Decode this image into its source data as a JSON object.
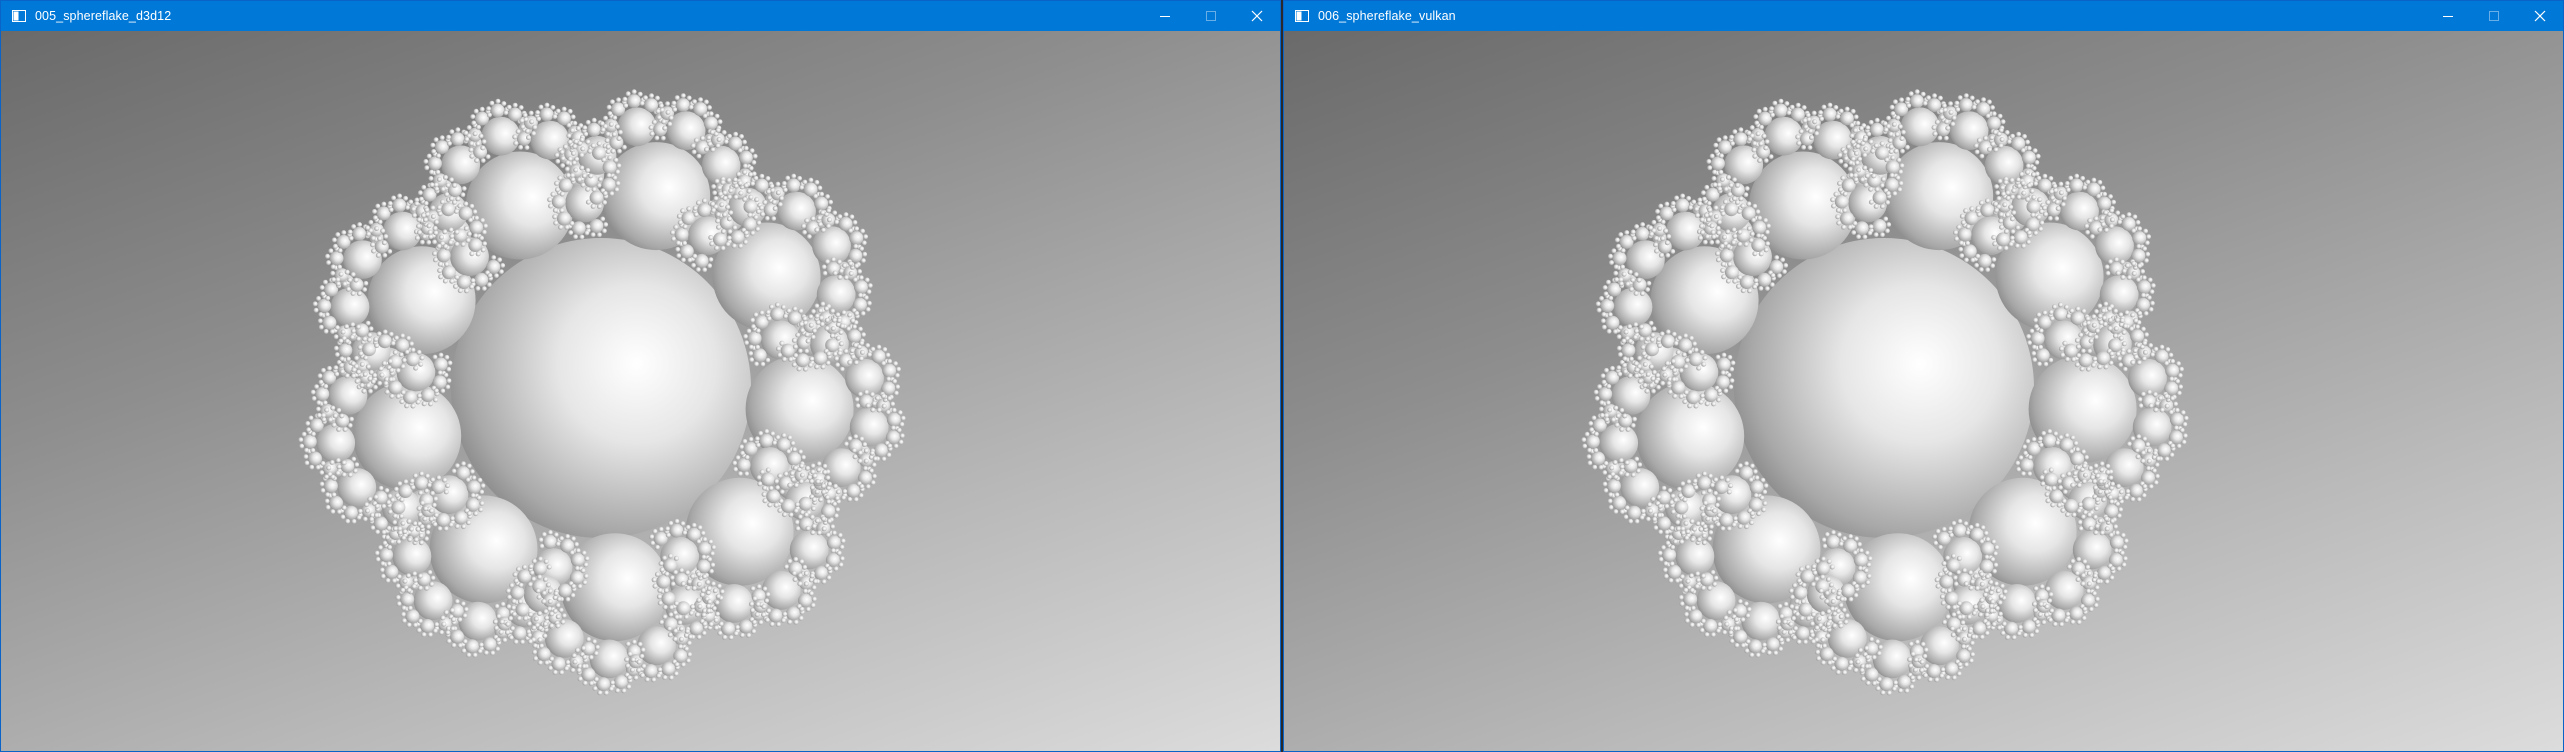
{
  "windows": [
    {
      "title": "005_sphereflake_d3d12",
      "controls": [
        "minimize-icon",
        "maximize-icon",
        "close-icon"
      ],
      "content": "sphereflake-render"
    },
    {
      "title": "006_sphereflake_vulkan",
      "controls": [
        "minimize-icon",
        "maximize-icon",
        "close-icon"
      ],
      "content": "sphereflake-render"
    }
  ],
  "colors": {
    "titlebar": "#0078d7",
    "title_text": "#ffffff",
    "background_dark": "#6a6a6a",
    "background_light": "#dcdcdc"
  }
}
